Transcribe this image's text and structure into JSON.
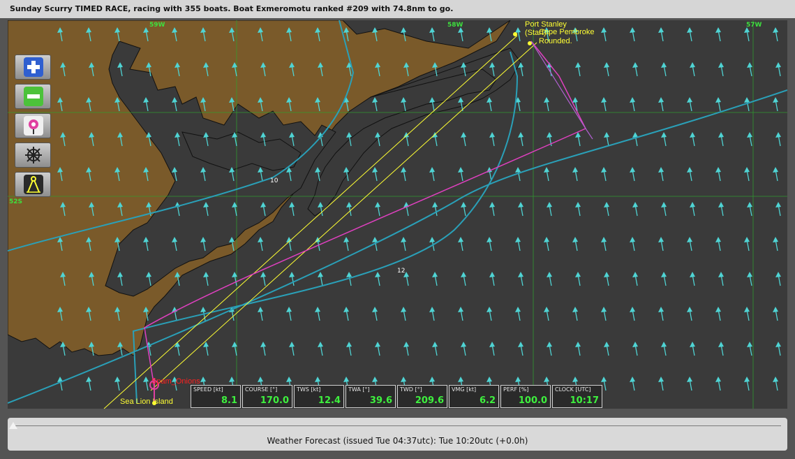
{
  "title": "Sunday Scurry TIMED RACE, racing with 355 boats. Boat Exmeromotu ranked #209 with 74.8nm to go.",
  "map": {
    "lon_labels": [
      "59W",
      "58W",
      "57W"
    ],
    "lat_labels": [
      "52S"
    ],
    "contour_labels": [
      "10",
      "12"
    ],
    "places": {
      "port_stanley": "Port Stanley",
      "start": "(Start)",
      "cape_pembroke": "Cape Pembroke",
      "rounded": "Rounded.",
      "sea_lion_island": "Sea Lion Island",
      "boat_name": "Spam_Onions"
    },
    "controls": [
      {
        "name": "zoom-in-icon",
        "color": "#2f5fd0"
      },
      {
        "name": "zoom-out-icon",
        "color": "#4cc23a"
      },
      {
        "name": "center-boat-icon",
        "color": "#e040a0"
      },
      {
        "name": "helm-icon",
        "color": "#888888"
      },
      {
        "name": "compass-measure-icon",
        "color": "#ffff33"
      }
    ],
    "colors": {
      "land": "#7a5a2a",
      "sea": "#3a3a3a",
      "grid": "#2ea32e",
      "route": "#e040c0",
      "layline": "#ffff33",
      "isoline": "#2aa0b8",
      "wind": "#4fd4d4"
    }
  },
  "instruments": [
    {
      "label": "SPEED [kt]",
      "value": "8.1"
    },
    {
      "label": "COURSE [°]",
      "value": "170.0"
    },
    {
      "label": "TWS [kt]",
      "value": "12.4"
    },
    {
      "label": "TWA [°]",
      "value": "39.6"
    },
    {
      "label": "TWD [°]",
      "value": "209.6"
    },
    {
      "label": "VMG [kt]",
      "value": "6.2"
    },
    {
      "label": "PERF [%]",
      "value": "100.0"
    },
    {
      "label": "CLOCK [UTC]",
      "value": "10:17"
    }
  ],
  "forecast": {
    "text": "Weather Forecast  (issued Tue 04:37utc): Tue 10:20utc  (+0.0h)",
    "slider_position": 0
  }
}
